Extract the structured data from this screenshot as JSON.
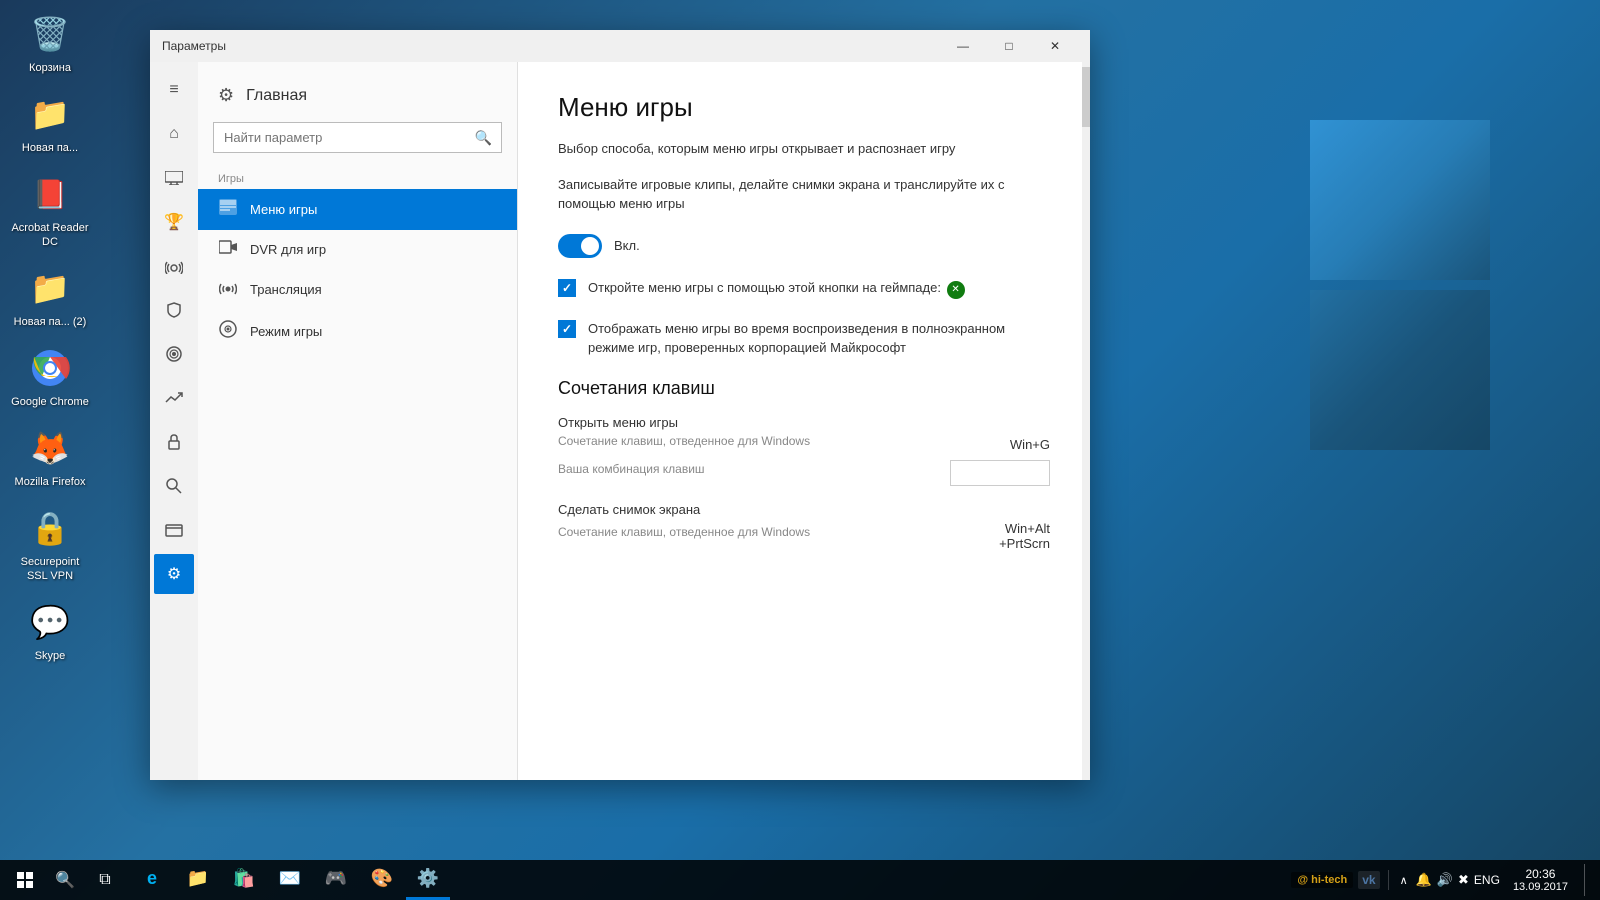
{
  "desktop": {
    "icons": [
      {
        "id": "recycle-bin",
        "label": "Корзина",
        "symbol": "🗑️"
      },
      {
        "id": "new-folder1",
        "label": "Новая па...",
        "symbol": "📁"
      },
      {
        "id": "acrobat",
        "label": "Acrobat Reader DC",
        "symbol": "📕"
      },
      {
        "id": "new-folder2",
        "label": "Новая па... (2)",
        "symbol": "📁"
      },
      {
        "id": "google-chrome",
        "label": "Google Chrome",
        "symbol": "🌐"
      },
      {
        "id": "mozilla-firefox",
        "label": "Mozilla Firefox",
        "symbol": "🦊"
      },
      {
        "id": "securepoint",
        "label": "Securepoint SSL VPN",
        "symbol": "🔒"
      },
      {
        "id": "skype",
        "label": "Skype",
        "symbol": "💬"
      }
    ]
  },
  "taskbar": {
    "start_label": "⊞",
    "search_icon": "🔍",
    "task_view_icon": "⧉",
    "edge_icon": "e",
    "explorer_icon": "📁",
    "store_icon": "🛍️",
    "mail_icon": "✉️",
    "xbox_icon": "🎮",
    "paint_icon": "🎨",
    "settings_icon": "⚙️",
    "sys_icons": "∧  🔔  🔊  ✖",
    "language": "ENG",
    "time": "20:36",
    "date": "13.09.2017",
    "hitech_label": "@ hi-tech",
    "vk_icon": "vk"
  },
  "window": {
    "title": "Параметры",
    "min_label": "—",
    "max_label": "□",
    "close_label": "✕"
  },
  "nav_rail": {
    "items": [
      {
        "id": "hamburger",
        "symbol": "≡",
        "active": false
      },
      {
        "id": "home-nav",
        "symbol": "⌂",
        "active": false
      },
      {
        "id": "screen",
        "symbol": "🖥",
        "active": false
      },
      {
        "id": "trophy",
        "symbol": "🏆",
        "active": false
      },
      {
        "id": "broadcast",
        "symbol": "📡",
        "active": false
      },
      {
        "id": "shield",
        "symbol": "🛡",
        "active": false
      },
      {
        "id": "target",
        "symbol": "🎯",
        "active": false
      },
      {
        "id": "trending",
        "symbol": "📈",
        "active": false
      },
      {
        "id": "lock",
        "symbol": "🔒",
        "active": false
      },
      {
        "id": "search-nav",
        "symbol": "🔍",
        "active": false
      },
      {
        "id": "card",
        "symbol": "💳",
        "active": false
      },
      {
        "id": "gear-nav",
        "symbol": "⚙",
        "active": true
      }
    ]
  },
  "settings_panel": {
    "home_label": "Главная",
    "home_icon": "⚙",
    "search_placeholder": "Найти параметр",
    "search_icon": "🔍",
    "section_label": "Игры",
    "nav_items": [
      {
        "id": "game-menu",
        "icon": "▦",
        "label": "Меню игры",
        "active": true
      },
      {
        "id": "dvr",
        "icon": "📹",
        "label": "DVR для игр",
        "active": false
      },
      {
        "id": "broadcast",
        "icon": "📡",
        "label": "Трансляция",
        "active": false
      },
      {
        "id": "game-mode",
        "icon": "🎯",
        "label": "Режим игры",
        "active": false
      }
    ]
  },
  "content": {
    "page_title": "Меню игры",
    "desc1": "Выбор способа, которым меню игры открывает и распознает игру",
    "desc2": "Записывайте игровые клипы, делайте снимки экрана и транслируйте их с помощью меню игры",
    "toggle_label": "Вкл.",
    "checkbox1_text": "Откройте меню игры с помощью этой кнопки на геймпаде:",
    "checkbox2_text": "Отображать меню игры во время воспроизведения в полноэкранном режиме игр, проверенных корпорацией Майкрософт",
    "shortcuts_title": "Сочетания клавиш",
    "shortcut1_label": "Открыть меню игры",
    "shortcut1_sublabel": "Сочетание клавиш, отведенное для Windows",
    "shortcut1_value": "Win+G",
    "shortcut1_input_label": "Ваша комбинация клавиш",
    "shortcut2_label": "Сделать снимок экрана",
    "shortcut2_sublabel": "Сочетание клавиш, отведенное для Windows",
    "shortcut2_value": "Win+Alt\n+PrtScrn"
  }
}
